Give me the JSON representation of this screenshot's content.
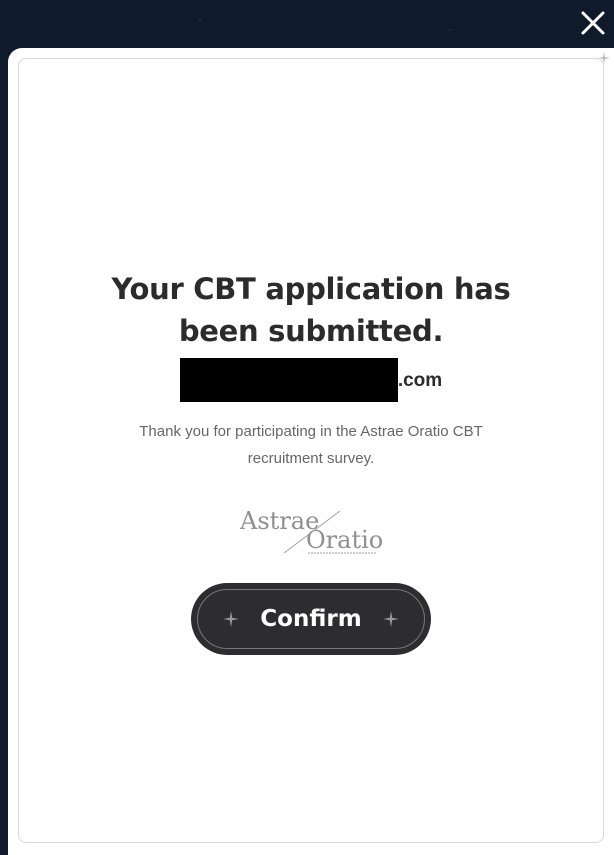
{
  "dialog": {
    "title": "Your CBT application has been submitted.",
    "email_suffix": ".com",
    "message": "Thank you for participating in the Astrae Oratio CBT recruitment survey.",
    "logo_text": "Astrae Oratio",
    "confirm_label": "Confirm"
  },
  "icons": {
    "close": "close-icon",
    "sparkle": "sparkle-icon"
  },
  "colors": {
    "backdrop": "#0f1b2a",
    "button": "#2d2d2f",
    "title": "#2b2b2b"
  }
}
